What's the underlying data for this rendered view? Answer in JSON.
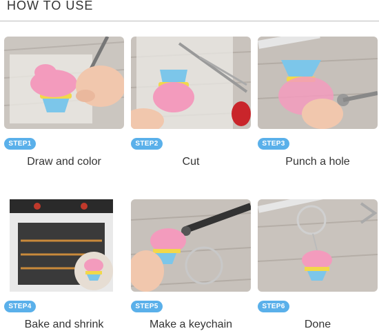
{
  "header": {
    "title": "HOW TO USE"
  },
  "steps": [
    {
      "badge": "STEP1",
      "caption": "Draw and color"
    },
    {
      "badge": "STEP2",
      "caption": "Cut"
    },
    {
      "badge": "STEP3",
      "caption": "Punch a hole"
    },
    {
      "badge": "STEP4",
      "caption": "Bake and shrink"
    },
    {
      "badge": "STEP5",
      "caption": "Make a keychain"
    },
    {
      "badge": "STEP6",
      "caption": "Done"
    }
  ],
  "colors": {
    "badge": "#5ab0ea",
    "frosting_pink": "#f39bbd",
    "cup_blue": "#7cc6ea",
    "cup_yellow": "#f2d84a",
    "wood": "#c9c3bd"
  }
}
